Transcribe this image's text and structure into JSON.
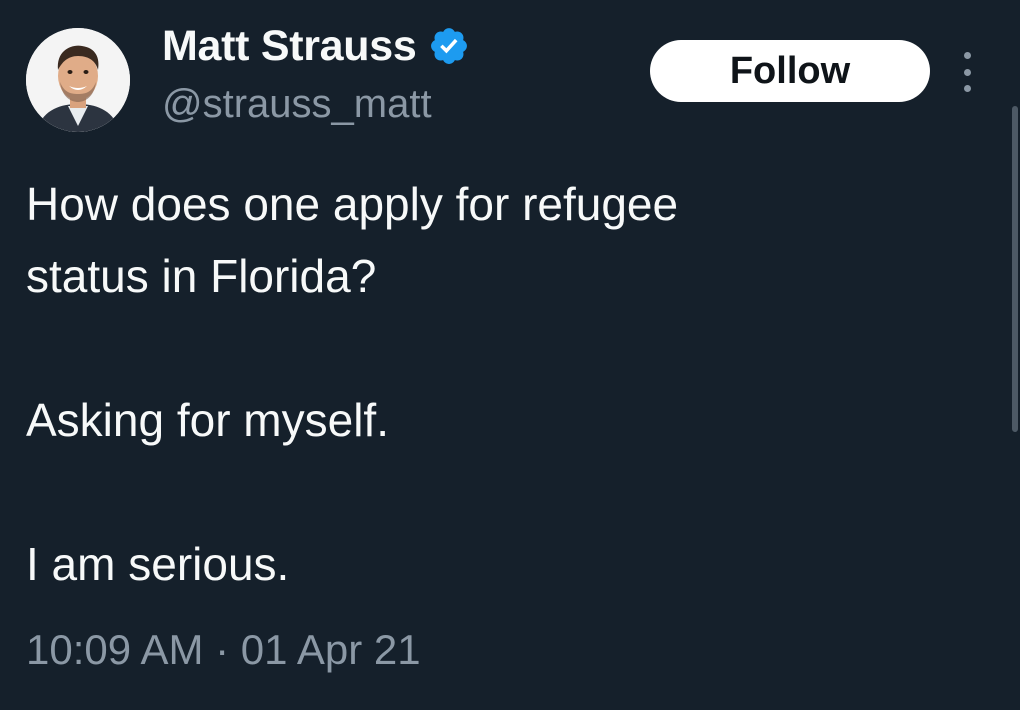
{
  "author": {
    "display_name": "Matt Strauss",
    "handle": "@strauss_matt",
    "verified": true,
    "verified_icon": "verified-badge-icon",
    "verified_color": "#1d9bf0"
  },
  "actions": {
    "follow_label": "Follow",
    "more_icon": "more-options-icon"
  },
  "tweet": {
    "lines": [
      "How does one apply for refugee",
      "status in Florida?",
      "Asking for myself.",
      "I am serious."
    ],
    "timestamp": "10:09 AM · 01 Apr 21"
  },
  "colors": {
    "background": "#15202b",
    "text": "#f7f9f9",
    "secondary_text": "#8b98a5",
    "button_bg": "#ffffff"
  }
}
